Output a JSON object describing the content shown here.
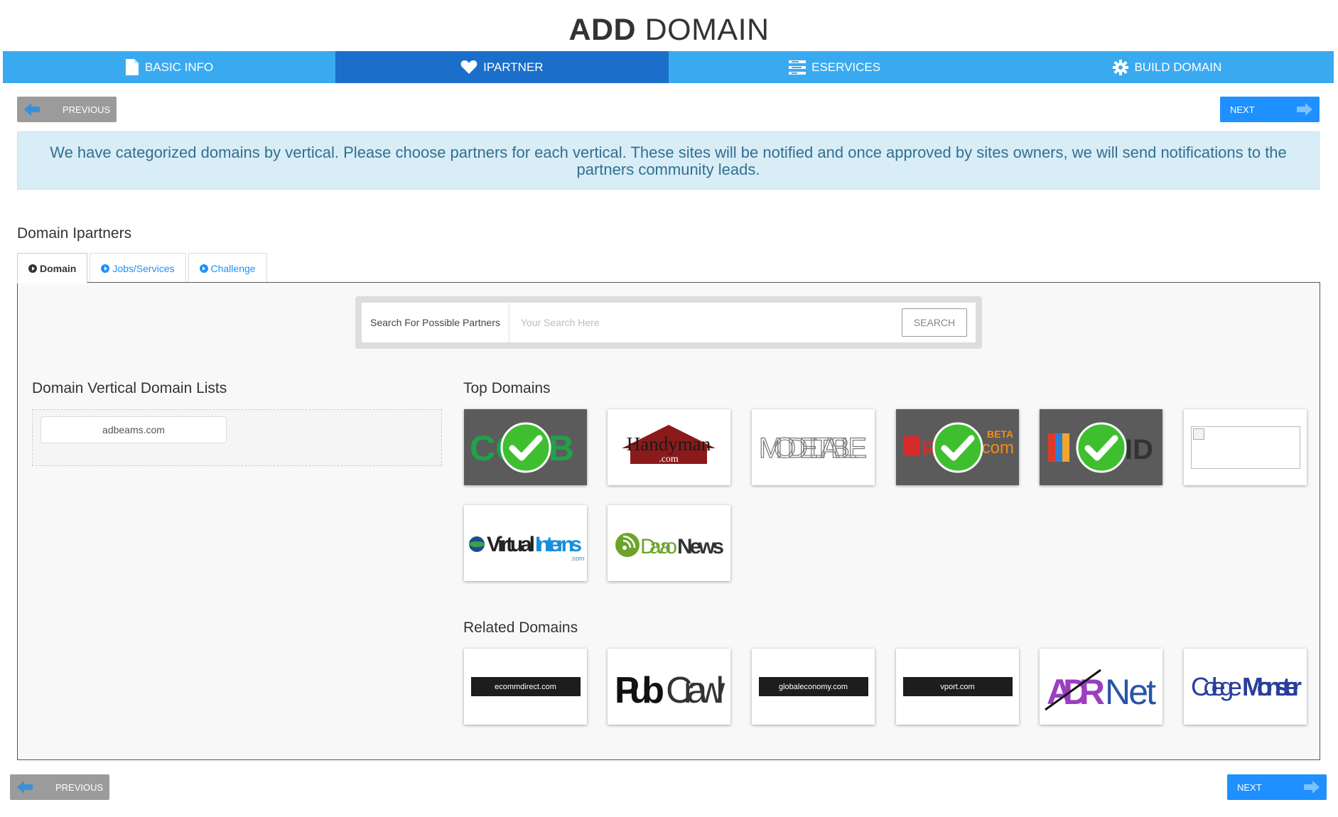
{
  "header": {
    "title_bold": "ADD",
    "title_rest": "DOMAIN"
  },
  "wizard": {
    "steps": [
      {
        "label": "BASIC INFO",
        "icon": "document-icon",
        "active": false
      },
      {
        "label": "IPARTNER",
        "icon": "heart-icon",
        "active": true
      },
      {
        "label": "ESERVICES",
        "icon": "list-icon",
        "active": false
      },
      {
        "label": "BUILD DOMAIN",
        "icon": "gear-icon",
        "active": false
      }
    ]
  },
  "nav": {
    "previous_label": "PREVIOUS",
    "next_label": "NEXT"
  },
  "alert": {
    "text": "We have categorized domains by vertical. Please choose partners for each vertical. These sites will be notified and once approved by sites owners, we will send notifications to the partners community leads."
  },
  "section": {
    "title": "Domain Ipartners"
  },
  "tabs": [
    {
      "label": "Domain",
      "active": true
    },
    {
      "label": "Jobs/Services",
      "active": false
    },
    {
      "label": "Challenge",
      "active": false
    }
  ],
  "search": {
    "addon": "Search For Possible Partners",
    "placeholder": "Your Search Here",
    "button": "SEARCH"
  },
  "vertical": {
    "title": "Domain Vertical Domain Lists",
    "items": [
      "adbeams.com"
    ]
  },
  "top_domains": {
    "title": "Top Domains",
    "items": [
      {
        "logo": "CO…IB",
        "selected": true
      },
      {
        "logo": "Handyman.com",
        "selected": false
      },
      {
        "logo": "MODELTABLE",
        "selected": false
      },
      {
        "logo": "R…s.com BETA",
        "selected": true
      },
      {
        "logo": "S…ID",
        "selected": true
      },
      {
        "logo": "",
        "selected": false
      },
      {
        "logo": "VirtualInterns.com",
        "selected": false
      },
      {
        "logo": "DavaoNews",
        "selected": false
      }
    ]
  },
  "related_domains": {
    "title": "Related Domains",
    "items": [
      {
        "label": "ecommdirect.com"
      },
      {
        "logo": "PubCrawl"
      },
      {
        "label": "globaleconomy.com"
      },
      {
        "label": "vport.com"
      },
      {
        "logo": "ADRNet"
      },
      {
        "logo": "CollegeMonster"
      }
    ]
  },
  "colors": {
    "step": "#3aaaf0",
    "step_active": "#1b6ec9",
    "next": "#1e90ff",
    "prev": "#9b9b9b",
    "alert_bg": "#d9edf7",
    "alert_text": "#31708f"
  }
}
